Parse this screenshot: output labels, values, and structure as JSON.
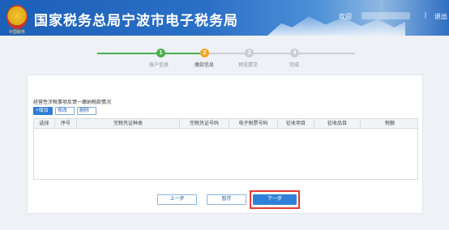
{
  "header": {
    "emblem_text": "中国税务",
    "title": "国家税务总局宁波市电子税务局",
    "welcome": "欢迎",
    "separator": "|",
    "logout": "退出"
  },
  "stepper": {
    "steps": [
      {
        "number": "1",
        "label": "账户信息",
        "status": "done"
      },
      {
        "number": "2",
        "label": "缴款信息",
        "status": "current"
      },
      {
        "number": "3",
        "label": "预览提交",
        "status": "pending"
      },
      {
        "number": "4",
        "label": "完成",
        "status": "pending"
      }
    ]
  },
  "section": {
    "title": "经营性涉税事项反馈一缴纳税款情况",
    "toolbar": {
      "add": "+增加",
      "edit": "修改",
      "delete": "删除"
    }
  },
  "table": {
    "columns": [
      "选择",
      "序号",
      "完税凭证种类",
      "完税凭证号码",
      "电子税票号码",
      "征收项目",
      "征收品目",
      "税额"
    ],
    "rows": []
  },
  "footer": {
    "prev": "上一步",
    "save": "暂存",
    "next": "下一步"
  },
  "colors": {
    "accent": "#2f80d8",
    "done": "#4caf50",
    "current": "#f5a623",
    "highlight": "#e53935"
  }
}
